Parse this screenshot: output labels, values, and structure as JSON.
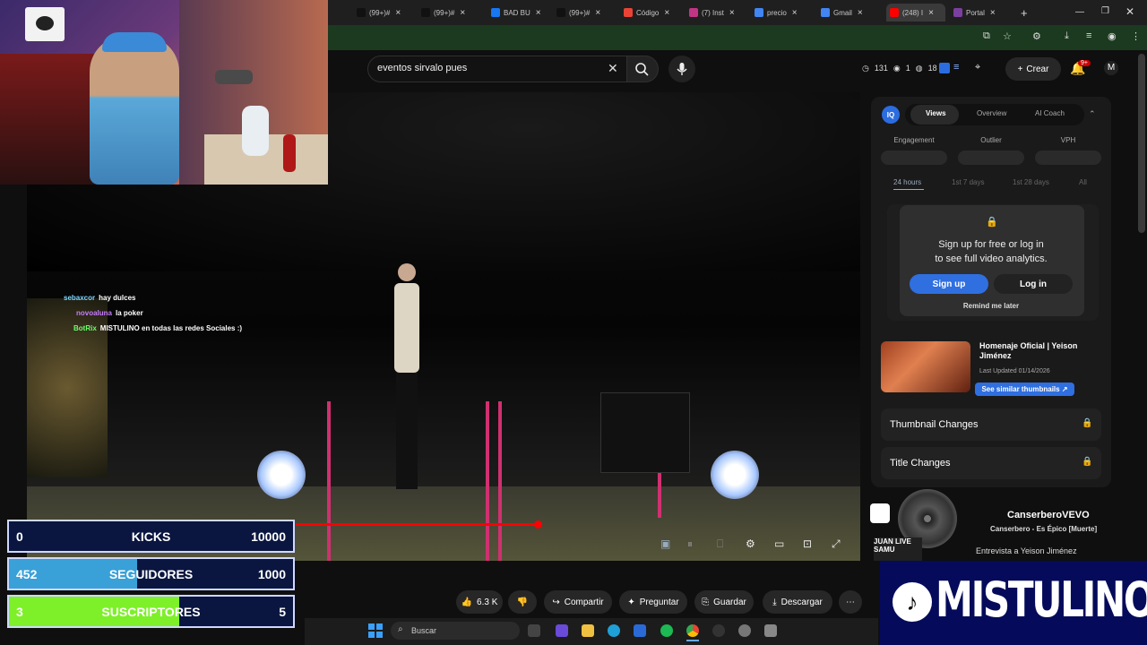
{
  "browser": {
    "tabs": [
      {
        "label": "(99+)C",
        "color": "#333"
      },
      {
        "label": "(99+)#",
        "color": "#111"
      },
      {
        "label": "(99+)#",
        "color": "#111"
      },
      {
        "label": "BAD BU",
        "color": "#1877f2"
      },
      {
        "label": "(99+)#",
        "color": "#111"
      },
      {
        "label": "Código",
        "color": "#ea4335"
      },
      {
        "label": "(7) Inst",
        "color": "#c13584"
      },
      {
        "label": "precio",
        "color": "#4285f4"
      },
      {
        "label": "Gmail",
        "color": "#4285f4"
      },
      {
        "label": "(248) I",
        "color": "#ff0000"
      },
      {
        "label": "Portal",
        "color": "#7b3fa0"
      }
    ],
    "new_tab_glyph": "+",
    "close_glyph": "×"
  },
  "youtube": {
    "search": {
      "value": "eventos sirvalo pues",
      "clear_glyph": "✕"
    },
    "stats": {
      "views": "131",
      "watch": "1",
      "count": "18"
    },
    "create_label": "Crear",
    "notifications_badge": "9+"
  },
  "chat": [
    {
      "user": "sebaxcor",
      "message": "hay dulces",
      "color": "#7fd7ff"
    },
    {
      "user": "novoaluna",
      "message": "la poker",
      "color": "#c77dff"
    },
    {
      "user": "BotRix",
      "message": "MISTULINO en todas las redes Sociales :)",
      "color": "#6cff6c"
    }
  ],
  "counters": [
    {
      "current": "0",
      "label": "KICKS",
      "goal": "10000",
      "progress": 0.0,
      "fill": "#1d3aa8"
    },
    {
      "current": "452",
      "label": "SEGUIDORES",
      "goal": "1000",
      "progress": 0.452,
      "fill": "#3aa0d8"
    },
    {
      "current": "3",
      "label": "SUSCRIPTORES",
      "goal": "5",
      "progress": 0.6,
      "fill": "#7ef02a"
    }
  ],
  "analytics": {
    "logo": "IQ",
    "tabs": [
      "Views",
      "Overview",
      "AI Coach"
    ],
    "active_tab": "Views",
    "metrics": [
      "Engagement",
      "Outlier",
      "VPH"
    ],
    "ranges": [
      "24 hours",
      "1st 7 days",
      "1st 28 days",
      "All"
    ],
    "active_range": "24 hours",
    "lock_message_line1": "Sign up for free or log in",
    "lock_message_line2": "to see full video analytics.",
    "signup_label": "Sign up",
    "login_label": "Log in",
    "remind_label": "Remind me later",
    "video_title": "Homenaje Oficial | Yeison Jiménez",
    "last_updated": "Last Updated 01/14/2026",
    "similar_label": "See similar thumbnails ↗",
    "sections": [
      "Thumbnail Changes",
      "Title Changes"
    ]
  },
  "now_playing": {
    "channel": "CanserberoVEVO",
    "track": "Canserbero - Es Épico [Muerte]",
    "next_item": "Entrevista a Yeison Jiménez",
    "thumb_text": "JUAN LIVE SAMU"
  },
  "actions": {
    "likes": "6.3 K",
    "share": "Compartir",
    "ask": "Preguntar",
    "save": "Guardar",
    "download": "Descargar"
  },
  "taskbar": {
    "search_placeholder": "Buscar"
  },
  "banner": {
    "name": "MISTULINO"
  }
}
